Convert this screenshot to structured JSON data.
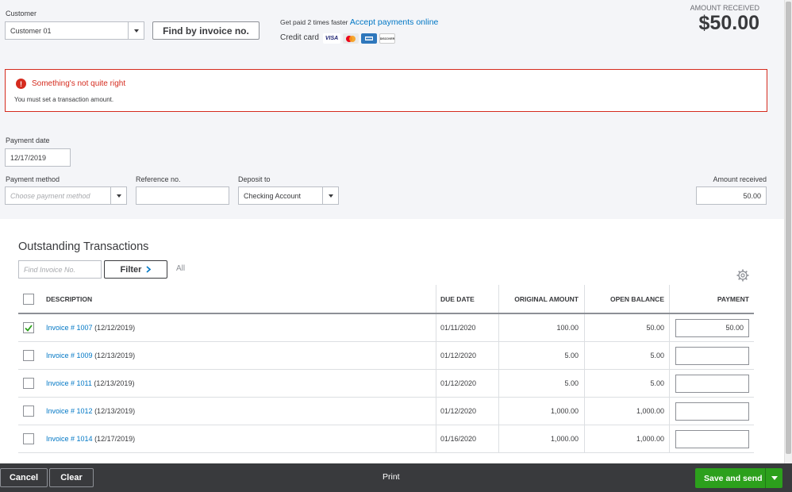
{
  "customer": {
    "label": "Customer",
    "value": "Customer 01",
    "find_button": "Find by invoice no."
  },
  "promo": {
    "text": "Get paid 2 times faster",
    "link": "Accept payments online",
    "credit_label": "Credit card",
    "card_icons": [
      "visa-icon",
      "mastercard-icon",
      "amex-icon",
      "discover-icon"
    ],
    "visa_text": "VISA",
    "discover_text": "DISCOVER"
  },
  "amount_received_header": {
    "label": "AMOUNT RECEIVED",
    "value": "$50.00"
  },
  "error": {
    "title": "Something's not quite right",
    "message": "You must set a transaction amount."
  },
  "form": {
    "payment_date_label": "Payment date",
    "payment_date": "12/17/2019",
    "payment_method_label": "Payment method",
    "payment_method_placeholder": "Choose payment method",
    "reference_label": "Reference no.",
    "reference_value": "",
    "deposit_label": "Deposit to",
    "deposit_value": "Checking Account",
    "amount_label": "Amount received",
    "amount_value": "50.00"
  },
  "outstanding": {
    "title": "Outstanding Transactions",
    "find_placeholder": "Find Invoice No.",
    "filter_label": "Filter",
    "all_label": "All",
    "columns": [
      "DESCRIPTION",
      "DUE DATE",
      "ORIGINAL AMOUNT",
      "OPEN BALANCE",
      "PAYMENT"
    ],
    "rows": [
      {
        "checked": true,
        "invoice": "Invoice # 1007",
        "date": "(12/12/2019)",
        "due": "01/11/2020",
        "original": "100.00",
        "open": "50.00",
        "payment": "50.00"
      },
      {
        "checked": false,
        "invoice": "Invoice # 1009",
        "date": "(12/13/2019)",
        "due": "01/12/2020",
        "original": "5.00",
        "open": "5.00",
        "payment": ""
      },
      {
        "checked": false,
        "invoice": "Invoice # 1011",
        "date": "(12/13/2019)",
        "due": "01/12/2020",
        "original": "5.00",
        "open": "5.00",
        "payment": ""
      },
      {
        "checked": false,
        "invoice": "Invoice # 1012",
        "date": "(12/13/2019)",
        "due": "01/12/2020",
        "original": "1,000.00",
        "open": "1,000.00",
        "payment": ""
      },
      {
        "checked": false,
        "invoice": "Invoice # 1014",
        "date": "(12/17/2019)",
        "due": "01/16/2020",
        "original": "1,000.00",
        "open": "1,000.00",
        "payment": ""
      }
    ]
  },
  "footer": {
    "cancel": "Cancel",
    "clear": "Clear",
    "print": "Print",
    "save": "Save and send"
  },
  "colors": {
    "error": "#d52b1e",
    "link": "#0077c5",
    "save": "#2ca01c",
    "footer": "#393a3d"
  }
}
